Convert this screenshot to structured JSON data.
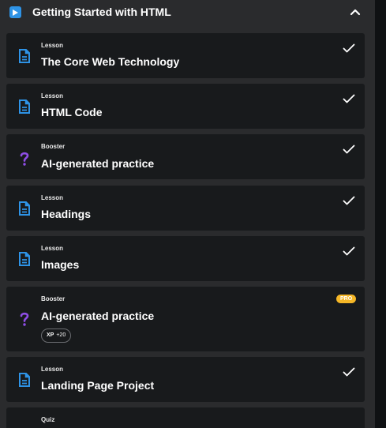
{
  "section": {
    "title": "Getting Started with HTML",
    "accent": "#2e93e6"
  },
  "items": [
    {
      "type": "Lesson",
      "title": "The Core Web Technology",
      "icon": "lesson-doc-icon",
      "completed": true
    },
    {
      "type": "Lesson",
      "title": "HTML Code",
      "icon": "lesson-doc-icon",
      "completed": true
    },
    {
      "type": "Booster",
      "title": "AI-generated practice",
      "icon": "question-mark-icon",
      "completed": true
    },
    {
      "type": "Lesson",
      "title": "Headings",
      "icon": "lesson-doc-icon",
      "completed": true
    },
    {
      "type": "Lesson",
      "title": "Images",
      "icon": "lesson-doc-icon",
      "completed": true
    },
    {
      "type": "Booster",
      "title": "AI-generated practice",
      "icon": "question-mark-icon",
      "completed": false,
      "badge": "PRO",
      "xp_label": "XP",
      "xp_value": "+20"
    },
    {
      "type": "Lesson",
      "title": "Landing Page Project",
      "icon": "lesson-doc-icon",
      "completed": true
    },
    {
      "type": "Quiz",
      "title": "",
      "icon": "",
      "completed": false
    }
  ],
  "colors": {
    "lesson_icon": "#2e93e6",
    "booster_icon": "#8f4ee6",
    "pro_badge": "#f5b727",
    "check": "#ffffff"
  }
}
